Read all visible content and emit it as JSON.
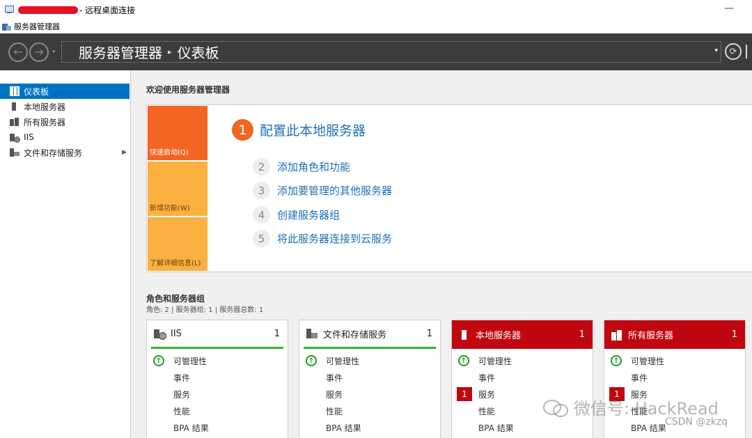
{
  "rdp_window": {
    "title_suffix": "- 远程桌面连接",
    "minimize": "—"
  },
  "app_window": {
    "title": "服务器管理器"
  },
  "nav": {
    "breadcrumb_root": "服务器管理器",
    "breadcrumb_sep": "▸",
    "breadcrumb_current": "仪表板",
    "back_glyph": "←",
    "forward_glyph": "→",
    "dropdown_glyph": "▾",
    "refresh_glyph": "⟳"
  },
  "sidebar": {
    "items": [
      {
        "label": "仪表板",
        "icon": "dashboard-icon",
        "active": true
      },
      {
        "label": "本地服务器",
        "icon": "server-icon"
      },
      {
        "label": "所有服务器",
        "icon": "servers-icon"
      },
      {
        "label": "IIS",
        "icon": "iis-icon"
      },
      {
        "label": "文件和存储服务",
        "icon": "file-storage-icon",
        "arrow": "▶"
      }
    ]
  },
  "welcome": {
    "heading": "欢迎使用服务器管理器",
    "tiles": [
      "快速启动(Q)",
      "新增功能(W)",
      "了解详细信息(L)"
    ],
    "steps": [
      {
        "num": "1",
        "label": "配置此本地服务器"
      },
      {
        "num": "2",
        "label": "添加角色和功能"
      },
      {
        "num": "3",
        "label": "添加要管理的其他服务器"
      },
      {
        "num": "4",
        "label": "创建服务器组"
      },
      {
        "num": "5",
        "label": "将此服务器连接到云服务"
      }
    ]
  },
  "roles": {
    "heading": "角色和服务器组",
    "summary": "角色: 2 | 服务器组: 1 | 服务器总数: 1",
    "cards": [
      {
        "title": "IIS",
        "count": "1",
        "style": "green",
        "rows": [
          "可管理性",
          "事件",
          "服务",
          "性能",
          "BPA 结果"
        ],
        "badge": ""
      },
      {
        "title": "文件和存储服务",
        "count": "1",
        "style": "green",
        "rows": [
          "可管理性",
          "事件",
          "服务",
          "性能",
          "BPA 结果"
        ],
        "badge": ""
      },
      {
        "title": "本地服务器",
        "count": "1",
        "style": "red",
        "rows": [
          "可管理性",
          "事件",
          "服务",
          "性能",
          "BPA 结果"
        ],
        "badge": "1"
      },
      {
        "title": "所有服务器",
        "count": "1",
        "style": "red",
        "rows": [
          "可管理性",
          "事件",
          "服务",
          "性能",
          "BPA 结果"
        ],
        "badge": "1"
      }
    ],
    "ok_glyph": "↑"
  },
  "watermarks": {
    "wechat": "微信号: HackRead",
    "csdn": "CSDN @zkzq"
  },
  "colors": {
    "accent_blue": "#0072c6",
    "orange": "#f26522",
    "amber": "#fbb040",
    "alert_red": "#c0070f",
    "ok_green": "#33b633"
  }
}
